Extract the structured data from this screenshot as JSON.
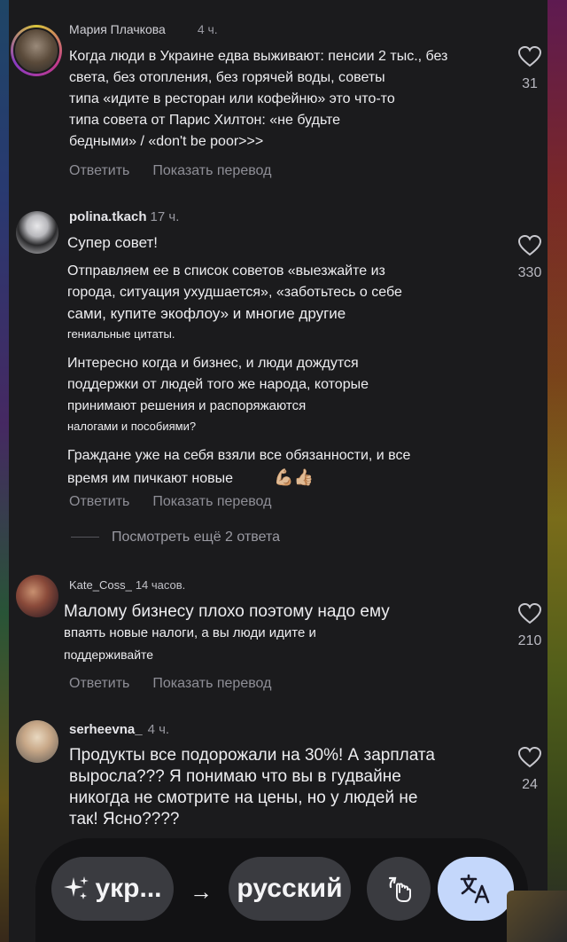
{
  "comments": [
    {
      "username": "Мария Плачкова",
      "time": "4 ч.",
      "lines": [
        "Когда люди в Украине едва выживают: пенсии 2 тыс., без",
        "света, без отопления, без горячей воды, советы",
        "типа «идите в ресторан или кофейню» это что-то",
        "типа совета от Парис Хилтон: «не будьте",
        "бедными» / «don't be poor>>>"
      ],
      "likes": "31"
    },
    {
      "username": "polina.tkach",
      "time": "17 ч.",
      "p1": "Супер совет!",
      "p2_lines": [
        "Отправляем ее в список советов «выезжайте из",
        "города, ситуация ухудшается», «заботьтесь о себе",
        "сами, купите экофлоу» и многие другие"
      ],
      "p2_small": "гениальные цитаты.",
      "p3_lines": [
        "Интересно когда и бизнес, и люди дождутся",
        "поддержки от людей того же народа, которые",
        "принимают решения и распоряжаются"
      ],
      "p3_small": "налогами и пособиями?",
      "p4_lines": [
        "Граждане уже на себя взяли все обязанности, и все",
        "время им пичкают новые"
      ],
      "emoji": "💪🏼👍🏼",
      "likes": "330"
    },
    {
      "username": "Kate_Coss_",
      "time": "14 часов.",
      "line1": "Малому бизнесу плохо поэтому надо ему",
      "small_lines": [
        "впаять новые налоги, а вы люди идите и",
        "поддерживайте"
      ],
      "likes": "210"
    },
    {
      "username": "serheevna_",
      "time": "4 ч.",
      "lines": [
        "Продукты все подорожали на 30%! А зарплата",
        "выросла??? Я понимаю что вы в гудвайне",
        "никогда не смотрите на цены, но у людей не",
        "так! Ясно????"
      ],
      "likes": "24"
    }
  ],
  "actions": {
    "reply": "Ответить",
    "translate": "Показать перевод"
  },
  "more_replies": "Посмотреть ещё 2 ответа",
  "translate_bar": {
    "source_lang": "укр...",
    "arrow": "→",
    "target_lang": "русский",
    "sparkle_icon": "sparkle-icon",
    "gesture_icon": "hand-gesture-icon",
    "translate_icon": "translate-icon"
  },
  "colors": {
    "background": "#1b1b1d",
    "translate_button": "#c4d7fb",
    "pill": "#3a3b40"
  }
}
